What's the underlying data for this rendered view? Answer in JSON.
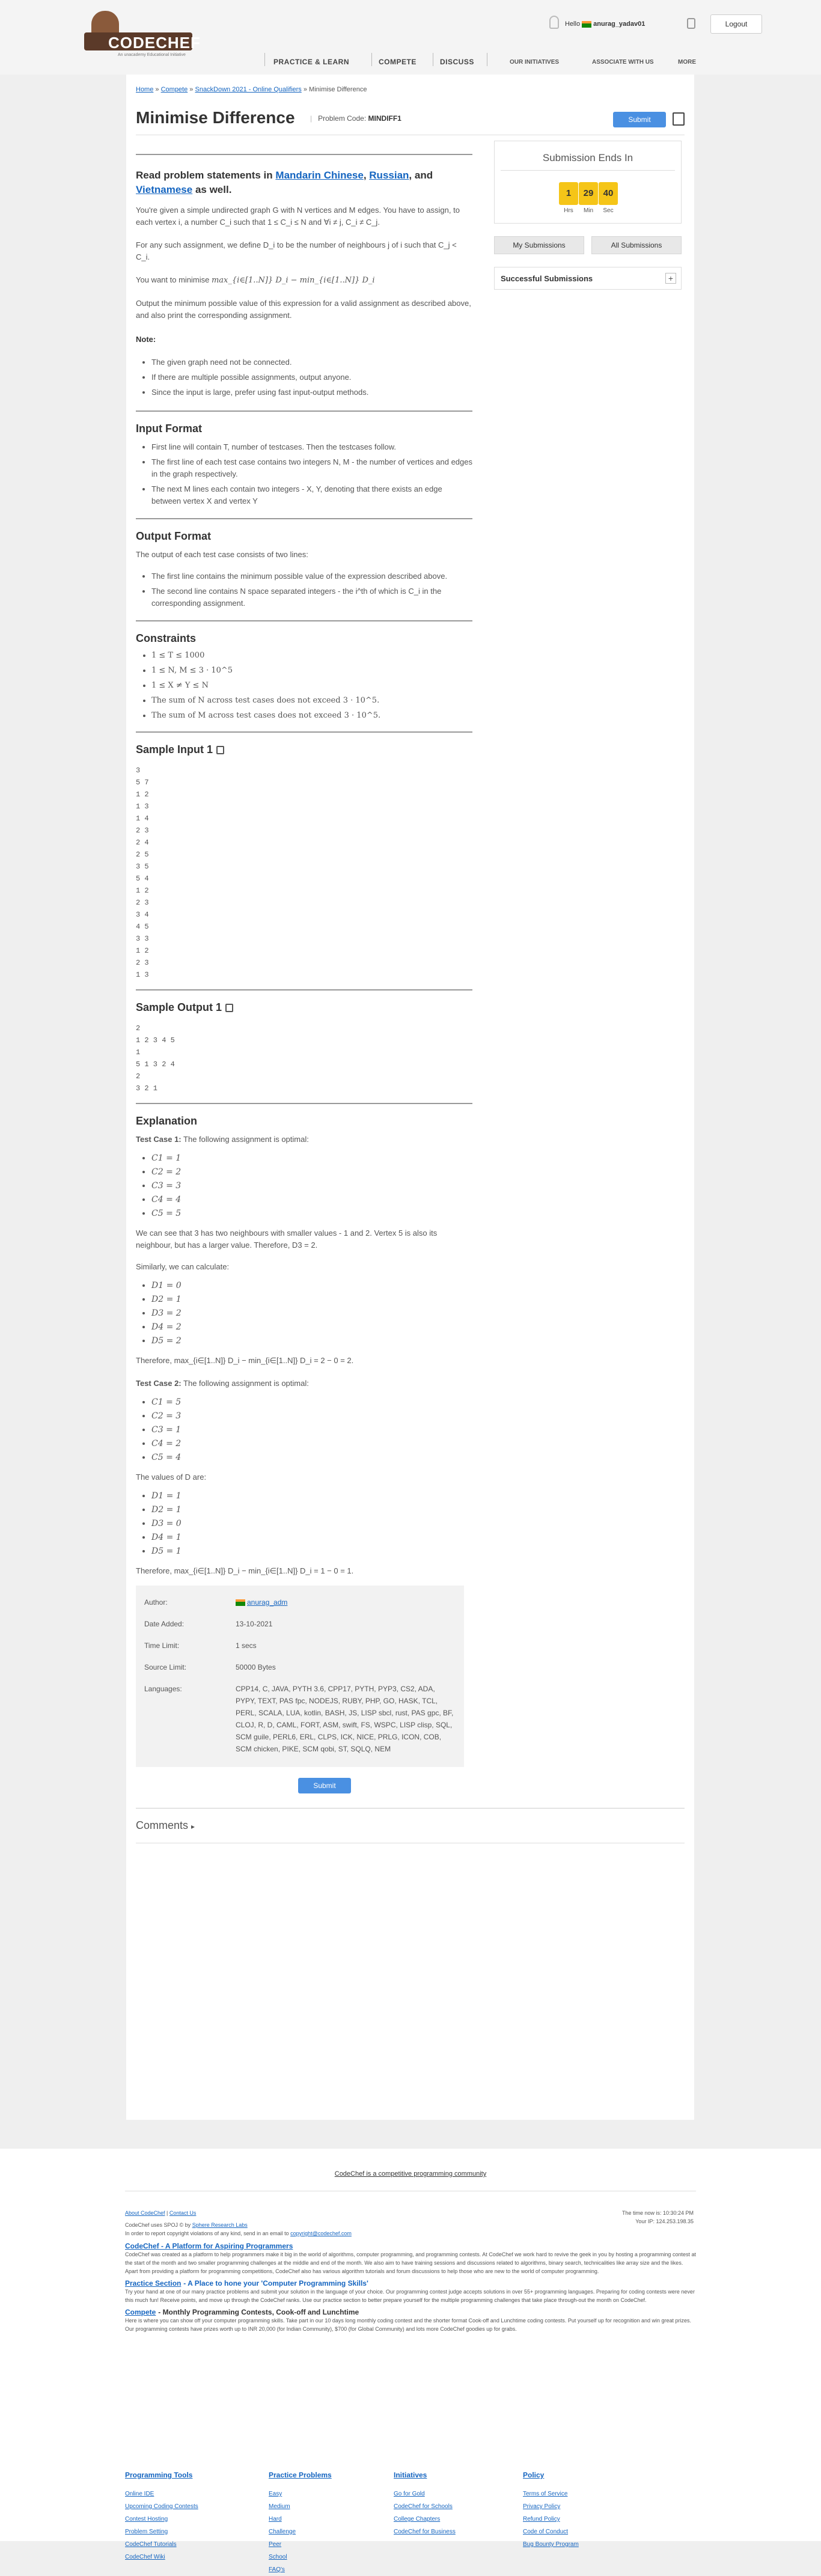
{
  "header": {
    "logo_text": "CODECHEF",
    "logo_sub": "An unacademy Educational Initiative",
    "nav": [
      "PRACTICE & LEARN",
      "COMPETE",
      "DISCUSS"
    ],
    "nav_small": [
      "OUR INITIATIVES",
      "ASSOCIATE WITH US",
      "MORE"
    ],
    "greeting": "Hello",
    "username": "anurag_yadav01",
    "logout_label": "Logout"
  },
  "breadcrumb": {
    "home": "Home",
    "sep": "»",
    "compete": "Compete",
    "contest": "SnackDown 2021 - Online Qualifiers",
    "current": "Minimise Difference"
  },
  "problem": {
    "title": "Minimise Difference",
    "code_label": "Problem Code:",
    "code": "MINDIFF1",
    "submit_label": "Submit"
  },
  "statement": {
    "read_prefix": "Read problem statements in",
    "lang1": "Mandarin Chinese",
    "lang2": "Russian",
    "lang3": "Vietnamese",
    "read_and": "and",
    "read_suffix": "as well.",
    "p1": "You're given a simple undirected graph G with N vertices and M edges. You have to assign, to each vertex i, a number C_i such that 1 ≤ C_i ≤ N and ∀i ≠ j, C_i ≠ C_j.",
    "p2": "For any such assignment, we define D_i to be the number of neighbours j of i such that C_j < C_i.",
    "p3_prefix": "You want to minimise",
    "p3_expr": "max_{i∈[1..N]} D_i − min_{i∈[1..N]} D_i",
    "p4": "Output the minimum possible value of this expression for a valid assignment as described above, and also print the corresponding assignment.",
    "note_label": "Note:",
    "notes": [
      "The given graph need not be connected.",
      "If there are multiple possible assignments, output anyone.",
      "Since the input is large, prefer using fast input-output methods."
    ]
  },
  "input_format": {
    "title": "Input Format",
    "items": [
      "First line will contain T, number of testcases. Then the testcases follow.",
      "The first line of each test case contains two integers N, M - the number of vertices and edges in the graph respectively.",
      "The next M lines each contain two integers - X, Y, denoting that there exists an edge between vertex X and vertex Y"
    ]
  },
  "output_format": {
    "title": "Output Format",
    "intro": "The output of each test case consists of two lines:",
    "items": [
      "The first line contains the minimum possible value of the expression described above.",
      "The second line contains N space separated integers - the i^th of which is C_i in the corresponding assignment."
    ]
  },
  "constraints": {
    "title": "Constraints",
    "items": [
      "1 ≤ T ≤ 1000",
      "1 ≤ N, M ≤ 3 · 10^5",
      "1 ≤ X ≠ Y ≤ N",
      "The sum of N across test cases does not exceed 3 · 10^5.",
      "The sum of M across test cases does not exceed 3 · 10^5."
    ]
  },
  "sample_input": {
    "title": "Sample Input 1",
    "lines": [
      "3",
      "5 7",
      "1 2",
      "1 3",
      "1 4",
      "2 3",
      "2 4",
      "2 5",
      "3 5",
      "5 4",
      "1 2",
      "2 3",
      "3 4",
      "4 5",
      "3 3",
      "1 2",
      "2 3",
      "1 3"
    ]
  },
  "sample_output": {
    "title": "Sample Output 1",
    "lines": [
      "2",
      "1 2 3 4 5",
      "1",
      "5 1 3 2 4",
      "2",
      "3 2 1"
    ]
  },
  "explanation": {
    "title": "Explanation",
    "tc1_label": "Test Case 1:",
    "tc1_intro": "The following assignment is optimal:",
    "tc1_c": [
      "C1 = 1",
      "C2 = 2",
      "C3 = 3",
      "C4 = 4",
      "C5 = 5"
    ],
    "tc1_p1": "We can see that 3 has two neighbours with smaller values - 1 and 2. Vertex 5 is also its neighbour, but has a larger value. Therefore, D3 = 2.",
    "tc1_p2": "Similarly, we can calculate:",
    "tc1_d": [
      "D1 = 0",
      "D2 = 1",
      "D3 = 2",
      "D4 = 2",
      "D5 = 2"
    ],
    "tc1_therefore": "Therefore, max_{i∈[1..N]} D_i − min_{i∈[1..N]} D_i = 2 − 0 = 2.",
    "tc2_label": "Test Case 2:",
    "tc2_intro": "The following assignment is optimal:",
    "tc2_c": [
      "C1 = 5",
      "C2 = 3",
      "C3 = 1",
      "C4 = 2",
      "C5 = 4"
    ],
    "tc2_p1": "The values of D are:",
    "tc2_d": [
      "D1 = 1",
      "D2 = 1",
      "D3 = 0",
      "D4 = 1",
      "D5 = 1"
    ],
    "tc2_therefore": "Therefore, max_{i∈[1..N]} D_i − min_{i∈[1..N]} D_i = 1 − 0 = 1."
  },
  "info": {
    "author_label": "Author:",
    "author": "anurag_adm",
    "date_label": "Date Added:",
    "date": "13-10-2021",
    "time_label": "Time Limit:",
    "time": "1 secs",
    "source_label": "Source Limit:",
    "source": "50000 Bytes",
    "lang_label": "Languages:",
    "languages": "CPP14, C, JAVA, PYTH 3.6, CPP17, PYTH, PYP3, CS2, ADA, PYPY, TEXT, PAS fpc, NODEJS, RUBY, PHP, GO, HASK, TCL, PERL, SCALA, LUA, kotlin, BASH, JS, LISP sbcl, rust, PAS gpc, BF, CLOJ, R, D, CAML, FORT, ASM, swift, FS, WSPC, LISP clisp, SQL, SCM guile, PERL6, ERL, CLPS, ICK, NICE, PRLG, ICON, COB, SCM chicken, PIKE, SCM qobi, ST, SQLQ, NEM",
    "submit_label": "Submit"
  },
  "comments_label": "Comments",
  "sidebar": {
    "timer_title": "Submission Ends In",
    "hrs": "1",
    "min": "29",
    "sec": "40",
    "hrs_label": "Hrs",
    "min_label": "Min",
    "sec_label": "Sec",
    "my_submissions": "My Submissions",
    "all_submissions": "All Submissions",
    "successful": "Successful Submissions",
    "plus": "+"
  },
  "footer": {
    "tagline": "CodeChef is a competitive programming community",
    "about": "About CodeChef",
    "contact": "Contact Us",
    "spoj_prefix": "CodeChef uses SPOJ © by",
    "spoj": "Sphere Research Labs",
    "copyright_prefix": "In order to report copyright violations of any kind, send in an email to",
    "copyright_email": "copyright@codechef.com",
    "time_now": "The time now is: 10:30:24 PM",
    "ip": "Your IP: 124.253.198.35",
    "s1_title": "CodeChef - A Platform for Aspiring Programmers",
    "s1_text": "CodeChef was created as a platform to help programmers make it big in the world of algorithms, computer programming, and programming contests. At CodeChef we work hard to revive the geek in you by hosting a programming contest at the start of the month and two smaller programming challenges at the middle and end of the month. We also aim to have training sessions and discussions related to algorithms, binary search, technicalities like array size and the likes. Apart from providing a platform for programming competitions, CodeChef also has various algorithm tutorials and forum discussions to help those who are new to the world of computer programming.",
    "s2_title": "Practice Section",
    "s2_title_suffix": "- A Place to hone your 'Computer Programming Skills'",
    "s2_text": "Try your hand at one of our many practice problems and submit your solution in the language of your choice. Our programming contest judge accepts solutions in over 55+ programming languages. Preparing for coding contests were never this much fun! Receive points, and move up through the CodeChef ranks. Use our practice section to better prepare yourself for the multiple programming challenges that take place through-out the month on CodeChef.",
    "s3_title": "Compete",
    "s3_title_suffix": "- Monthly Programming Contests, Cook-off and Lunchtime",
    "s3_text": "Here is where you can show off your computer programming skills. Take part in our 10 days long monthly coding contest and the shorter format Cook-off and Lunchtime coding contests. Put yourself up for recognition and win great prizes. Our programming contests have prizes worth up to INR 20,000 (for Indian Community), $700 (for Global Community) and lots more CodeChef goodies up for grabs.",
    "columns": [
      {
        "title": "Programming Tools",
        "links": [
          "Online IDE",
          "Upcoming Coding Contests",
          "Contest Hosting",
          "Problem Setting",
          "CodeChef Tutorials",
          "CodeChef Wiki"
        ]
      },
      {
        "title": "Practice Problems",
        "links": [
          "Easy",
          "Medium",
          "Hard",
          "Challenge",
          "Peer",
          "School",
          "FAQ's"
        ]
      },
      {
        "title": "Initiatives",
        "links": [
          "Go for Gold",
          "CodeChef for Schools",
          "College Chapters",
          "CodeChef for Business"
        ]
      },
      {
        "title": "Policy",
        "links": [
          "Terms of Service",
          "Privacy Policy",
          "Refund Policy",
          "Code of Conduct",
          "Bug Bounty Program"
        ]
      }
    ]
  }
}
